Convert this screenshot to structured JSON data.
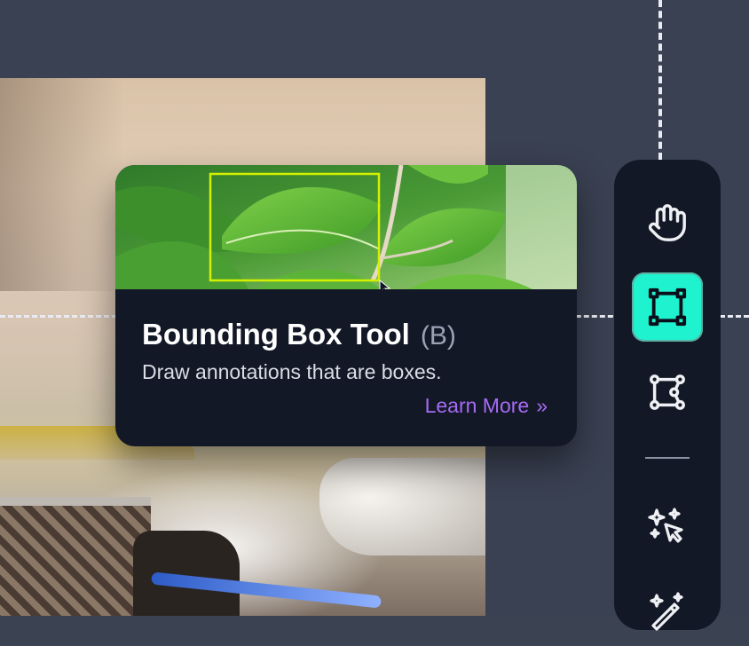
{
  "tooltip": {
    "title": "Bounding Box Tool",
    "shortcut": "(B)",
    "description": "Draw annotations that are boxes.",
    "link_label": "Learn More",
    "link_chevron": "»"
  },
  "toolbar": {
    "tools": [
      {
        "name": "pan",
        "icon": "hand-icon",
        "active": false
      },
      {
        "name": "bounding-box",
        "icon": "bounding-box-icon",
        "active": true
      },
      {
        "name": "polygon",
        "icon": "polygon-icon",
        "active": false
      },
      {
        "name": "smart-select",
        "icon": "magic-cursor-icon",
        "active": false
      },
      {
        "name": "magic-wand",
        "icon": "magic-wand-icon",
        "active": false
      }
    ]
  },
  "colors": {
    "canvas_background": "#3a4152",
    "panel_background": "#131826",
    "active_tool": "#1ff2cf",
    "link": "#a66bf5",
    "bbox_highlight": "#d4f000"
  }
}
